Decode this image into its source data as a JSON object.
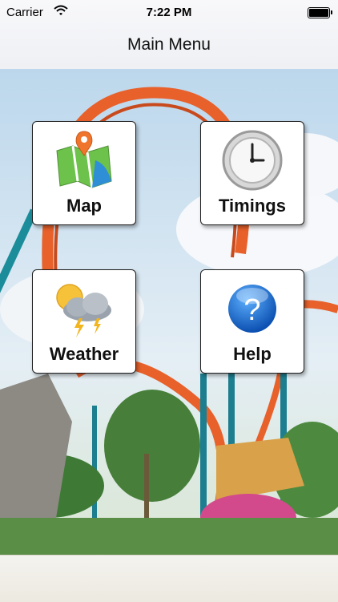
{
  "status_bar": {
    "carrier": "Carrier",
    "time": "7:22 PM"
  },
  "nav": {
    "title": "Main Menu"
  },
  "menu": {
    "map_label": "Map",
    "timings_label": "Timings",
    "weather_label": "Weather",
    "help_label": "Help"
  },
  "icons": {
    "map": "map-pin-icon",
    "timings": "clock-icon",
    "weather": "storm-cloud-icon",
    "help": "question-mark-icon"
  },
  "colors": {
    "coaster_track": "#e8602a",
    "sky": "#cfe3f2",
    "help_blue": "#1a67c9"
  }
}
